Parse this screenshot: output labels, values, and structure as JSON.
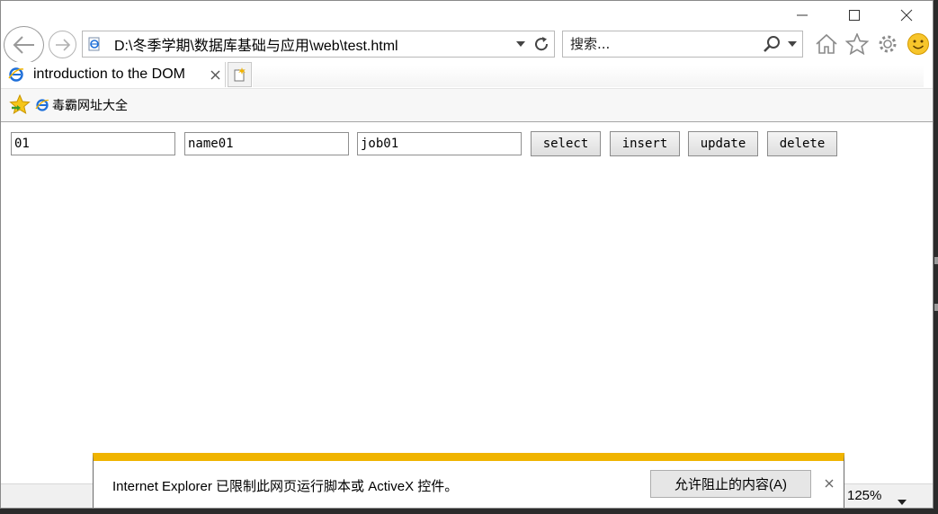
{
  "browser": {
    "address": {
      "url": "D:\\冬季学期\\数据库基础与应用\\web\\test.html"
    },
    "search": {
      "placeholder": "搜索..."
    },
    "tab": {
      "title": "introduction to the DOM"
    },
    "favorites": [
      {
        "label": "毒霸网址大全",
        "icon": "ie-icon"
      }
    ],
    "zoom": "125%",
    "toolbar_icons": [
      "home-icon",
      "favorites-star-icon",
      "settings-gear-icon",
      "smiley-feedback-icon"
    ]
  },
  "form": {
    "id_value": "01",
    "name_value": "name01",
    "job_value": "job01",
    "buttons": {
      "select": "select",
      "insert": "insert",
      "update": "update",
      "delete": "delete"
    }
  },
  "notification": {
    "message": "Internet Explorer 已限制此网页运行脚本或 ActiveX 控件。",
    "allow_label": "允许阻止的内容(A)"
  },
  "colors": {
    "notification_bar": "#f0b400",
    "ie_blue": "#1e6fd9"
  }
}
